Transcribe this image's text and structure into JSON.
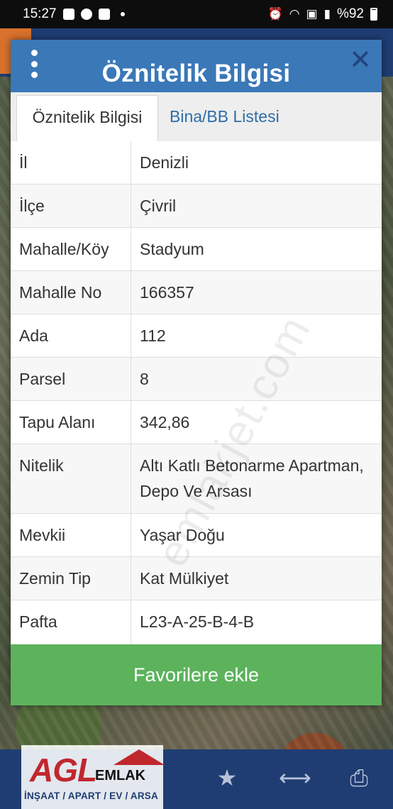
{
  "status_bar": {
    "time": "15:27",
    "battery": "%92"
  },
  "dialog": {
    "title": "Öznitelik Bilgisi",
    "tabs": [
      {
        "label": "Öznitelik Bilgisi",
        "active": true
      },
      {
        "label": "Bina/BB Listesi",
        "active": false
      }
    ],
    "rows": [
      {
        "label": "İl",
        "value": "Denizli"
      },
      {
        "label": "İlçe",
        "value": "Çivril"
      },
      {
        "label": "Mahalle/Köy",
        "value": "Stadyum"
      },
      {
        "label": "Mahalle No",
        "value": "166357"
      },
      {
        "label": "Ada",
        "value": "112"
      },
      {
        "label": "Parsel",
        "value": "8"
      },
      {
        "label": "Tapu Alanı",
        "value": "342,86"
      },
      {
        "label": "Nitelik",
        "value": "Altı Katlı Betonarme Apartman, Depo Ve Arsası"
      },
      {
        "label": "Mevkii",
        "value": "Yaşar Doğu"
      },
      {
        "label": "Zemin Tip",
        "value": "Kat Mülkiyet"
      },
      {
        "label": "Pafta",
        "value": "L23-A-25-B-4-B"
      }
    ],
    "favorite_button": "Favorilere ekle"
  },
  "watermark": "emlakjet.com",
  "logo": {
    "main": "AGL",
    "sub": "EMLAK",
    "tagline": "İNŞAAT / APART / EV / ARSA"
  },
  "colors": {
    "header": "#3a78b8",
    "favorite": "#5cb35c",
    "tab_link": "#2e6da8",
    "bottom_bar": "#1f3d73"
  }
}
